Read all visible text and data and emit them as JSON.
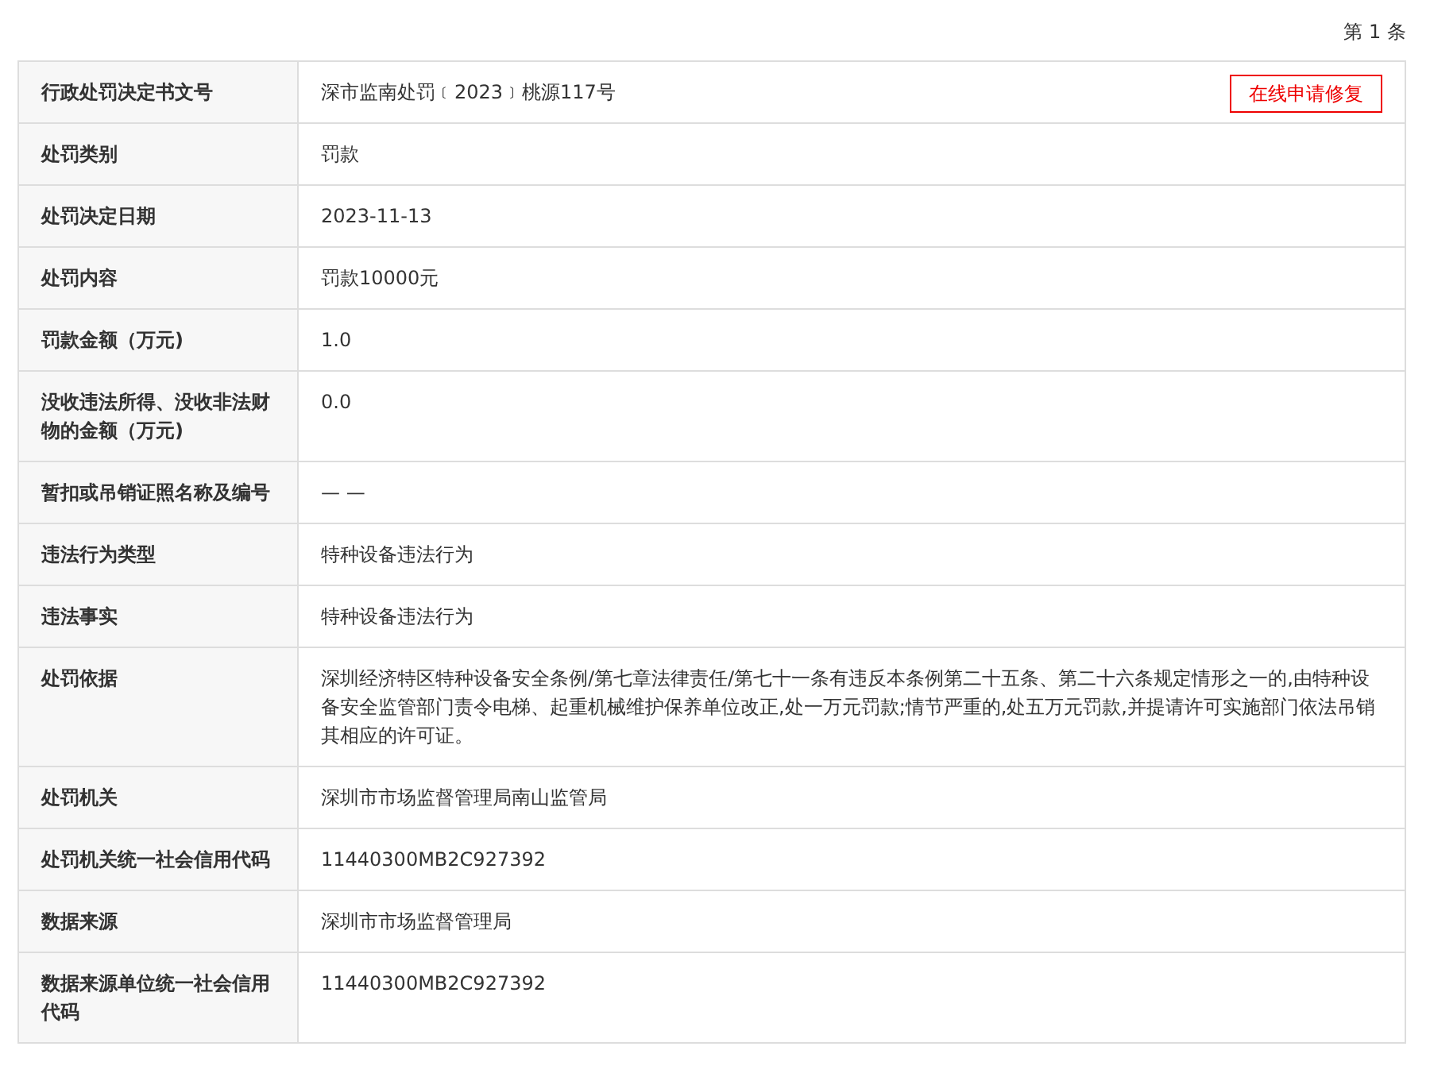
{
  "record_counter": "第 1 条",
  "repair_button": "在线申请修复",
  "rows": [
    {
      "label": "行政处罚决定书文号",
      "value": "深市监南处罚﹝2023﹞桃源117号"
    },
    {
      "label": "处罚类别",
      "value": "罚款"
    },
    {
      "label": "处罚决定日期",
      "value": "2023-11-13"
    },
    {
      "label": "处罚内容",
      "value": "罚款10000元"
    },
    {
      "label": "罚款金额（万元)",
      "value": "1.0"
    },
    {
      "label": "没收违法所得、没收非法财物的金额（万元)",
      "value": "0.0"
    },
    {
      "label": "暂扣或吊销证照名称及编号",
      "value": "— —"
    },
    {
      "label": "违法行为类型",
      "value": "特种设备违法行为"
    },
    {
      "label": "违法事实",
      "value": "特种设备违法行为"
    },
    {
      "label": "处罚依据",
      "value": "深圳经济特区特种设备安全条例/第七章法律责任/第七十一条有违反本条例第二十五条、第二十六条规定情形之一的,由特种设备安全监管部门责令电梯、起重机械维护保养单位改正,处一万元罚款;情节严重的,处五万元罚款,并提请许可实施部门依法吊销其相应的许可证。"
    },
    {
      "label": "处罚机关",
      "value": "深圳市市场监督管理局南山监管局"
    },
    {
      "label": "处罚机关统一社会信用代码",
      "value": "11440300MB2C927392"
    },
    {
      "label": "数据来源",
      "value": "深圳市市场监督管理局"
    },
    {
      "label": "数据来源单位统一社会信用代码",
      "value": "11440300MB2C927392"
    }
  ]
}
